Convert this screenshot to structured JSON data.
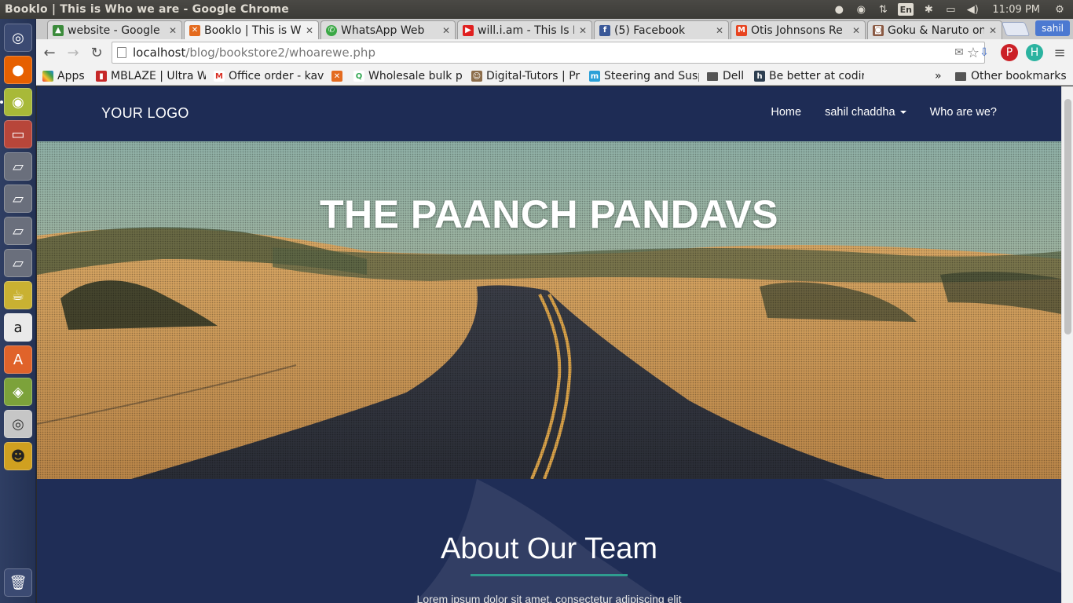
{
  "os": {
    "window_title": "Booklo | This is Who we are - Google Chrome",
    "clock": "11:09 PM",
    "lang": "En",
    "user": "sahil"
  },
  "launcher": {
    "items": [
      "dash-icon",
      "firefox-icon",
      "chrome-icon",
      "files-icon",
      "drive-icon",
      "drive-icon",
      "drive-icon",
      "drive-icon",
      "teapot-icon",
      "amazon-icon",
      "software-center-icon",
      "android-studio-icon",
      "disk-icon",
      "pidgin-icon",
      "trash-icon"
    ]
  },
  "tabs": [
    {
      "title": "website - Google I",
      "favicon": "drive-icon",
      "color": "#3b8b3b"
    },
    {
      "title": "Booklo | This is W",
      "favicon": "xampp-icon",
      "color": "#e46b1f"
    },
    {
      "title": "WhatsApp Web",
      "favicon": "whatsapp-icon",
      "color": "#3aa845"
    },
    {
      "title": "will.i.am - This Is L",
      "favicon": "youtube-icon",
      "color": "#e02020"
    },
    {
      "title": "(5) Facebook",
      "favicon": "facebook-icon",
      "color": "#3b5998"
    },
    {
      "title": "Otis Johnsons Re",
      "favicon": "m-icon",
      "color": "#e7431f"
    },
    {
      "title": "Goku & Naruto on",
      "favicon": "instagram-icon",
      "color": "#8a5a44"
    }
  ],
  "address": {
    "host": "localhost",
    "path": "/blog/bookstore2/whoarewe.php"
  },
  "bookmarks": {
    "apps": "Apps",
    "items": [
      {
        "label": "MBLAZE | Ultra W",
        "color": "#c62828"
      },
      {
        "label": "Office order - kav",
        "color": "#d93025"
      },
      {
        "label": "",
        "color": "#e46b1f"
      },
      {
        "label": "Wholesale bulk p",
        "color": "#33a853"
      },
      {
        "label": "Digital-Tutors | Pr",
        "color": "#8c6d4a"
      },
      {
        "label": "Steering and Susp",
        "color": "#2aa0d8"
      },
      {
        "label": "Dell",
        "color": "#555555"
      },
      {
        "label": "Be better at codir",
        "color": "#2d3e50"
      }
    ],
    "overflow": "»",
    "other": "Other bookmarks"
  },
  "site": {
    "logo": "YOUR LOGO",
    "nav": {
      "home": "Home",
      "user": "sahil chaddha",
      "who": "Who are we?"
    },
    "hero_title": "THE PAANCH PANDAVS",
    "about_title": "About Our Team",
    "about_text": "Lorem ipsum dolor sit amet, consectetur adipiscing elit"
  }
}
